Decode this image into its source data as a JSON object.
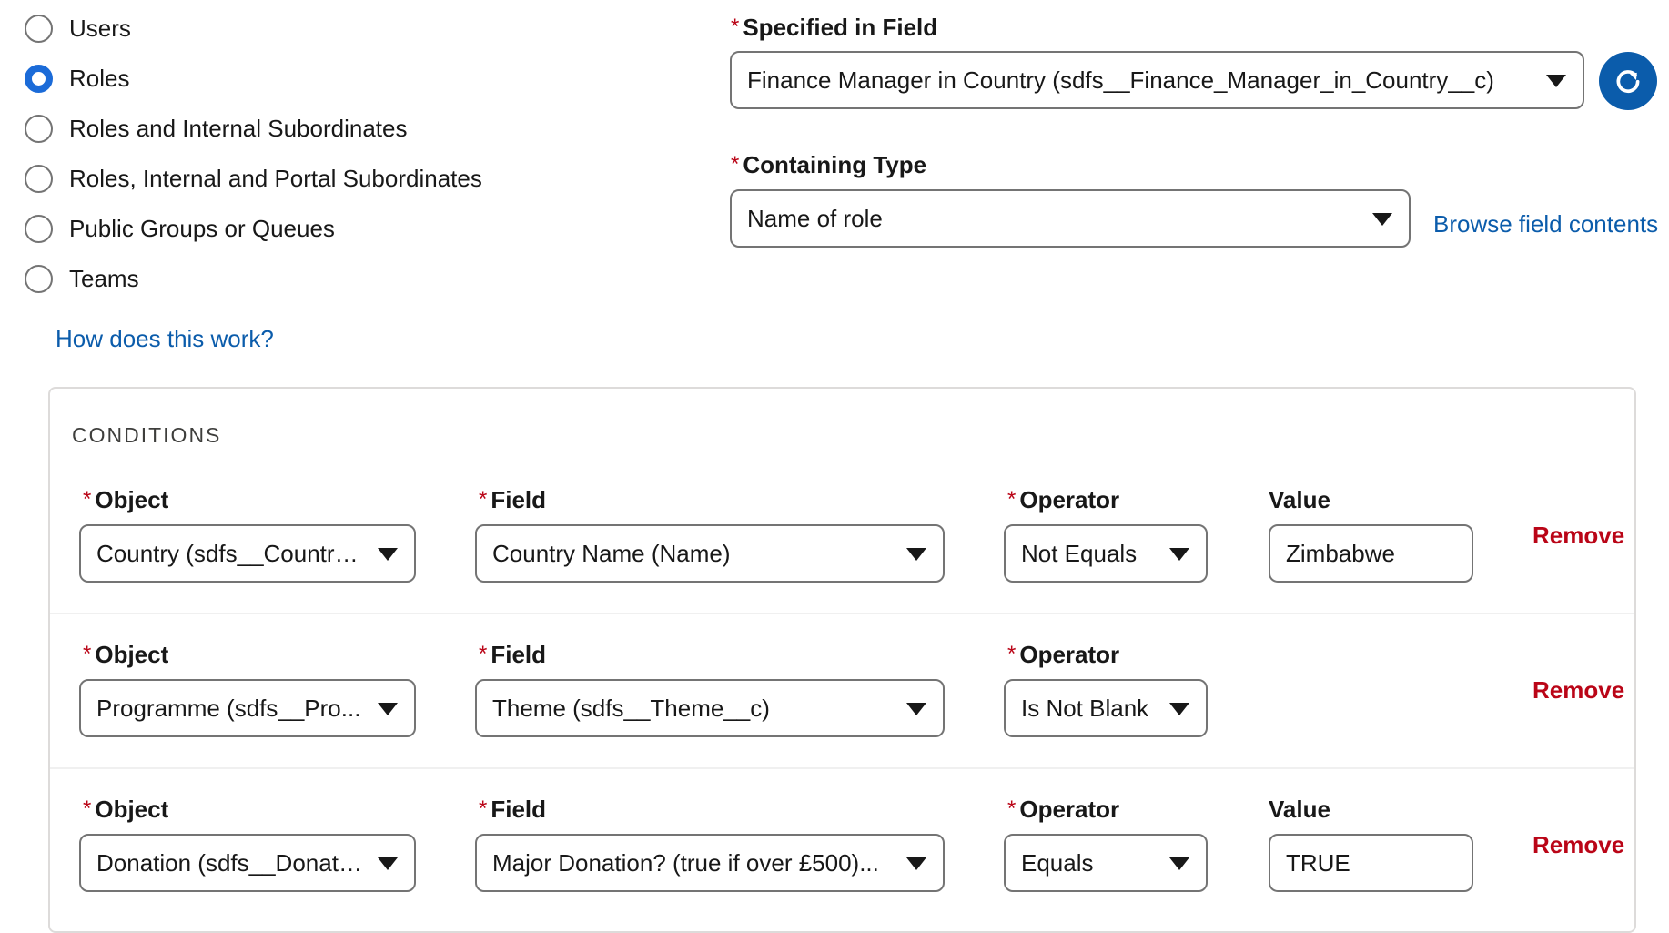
{
  "share_with": {
    "options": [
      "Users",
      "Roles",
      "Roles and Internal Subordinates",
      "Roles, Internal and Portal Subordinates",
      "Public Groups or Queues",
      "Teams"
    ],
    "selected": "Roles"
  },
  "help_link": "How does this work?",
  "specified_in_field": {
    "required_mark": "*",
    "label": "Specified in Field",
    "value": "Finance Manager in Country (sdfs__Finance_Manager_in_Country__c)",
    "refresh_icon": "refresh-icon"
  },
  "containing_type": {
    "required_mark": "*",
    "label": "Containing Type",
    "value": "Name of role",
    "browse_link": "Browse field contents"
  },
  "conditions": {
    "heading": "CONDITIONS",
    "labels": {
      "object": "Object",
      "field": "Field",
      "operator": "Operator",
      "value": "Value",
      "required_mark": "*"
    },
    "remove_label": "Remove",
    "rows": [
      {
        "object": "Country (sdfs__Country...",
        "field": "Country Name (Name)",
        "operator": "Not Equals",
        "value": "Zimbabwe"
      },
      {
        "object": "Programme (sdfs__Pro...",
        "field": "Theme (sdfs__Theme__c)",
        "operator": "Is Not Blank"
      },
      {
        "object": "Donation (sdfs__Donati...",
        "field": "Major Donation? (true if over £500)...",
        "operator": "Equals",
        "value": "TRUE"
      }
    ]
  },
  "colors": {
    "accent": "#0b5cab",
    "required": "#ba0517",
    "border": "#747474"
  }
}
